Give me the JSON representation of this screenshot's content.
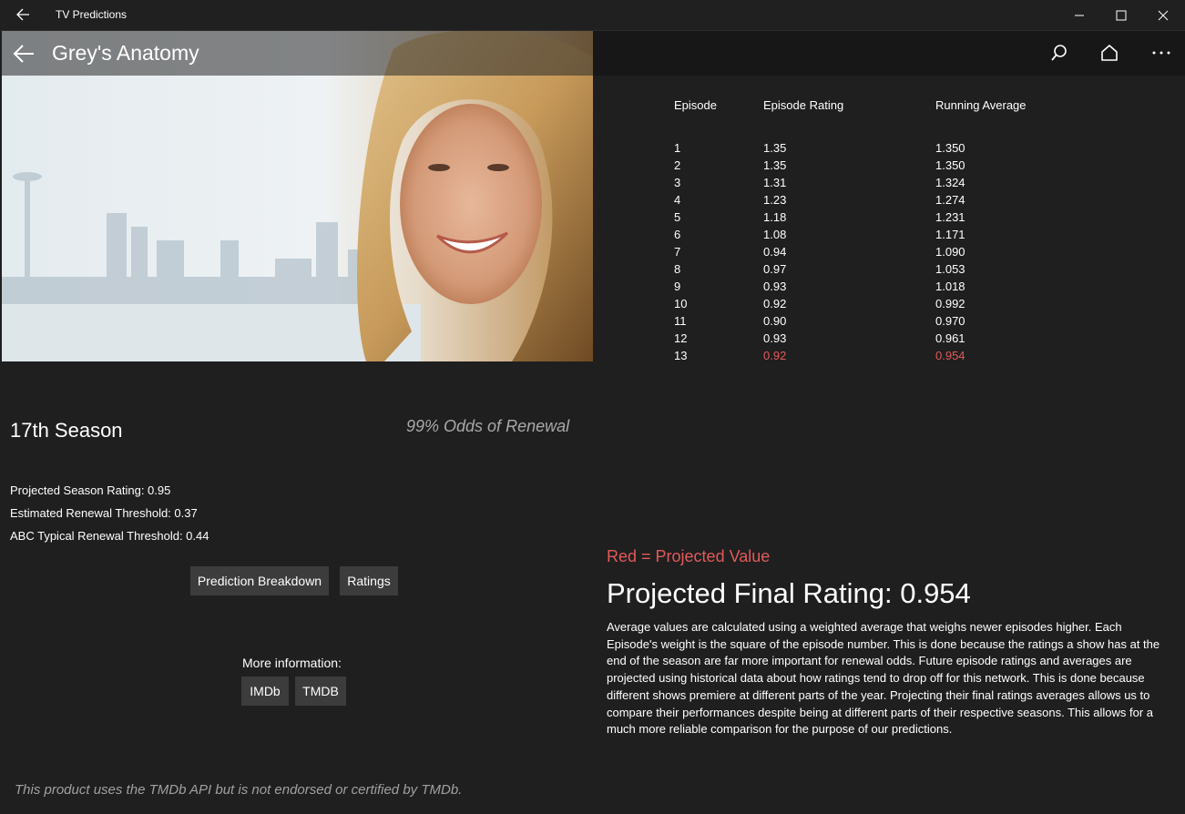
{
  "window": {
    "title": "TV Predictions",
    "back_icon": "back-arrow-icon",
    "controls": [
      "minimize-icon",
      "maximize-icon",
      "close-icon"
    ]
  },
  "header": {
    "show_title": "Grey's Anatomy",
    "back_icon": "back-arrow-icon",
    "actions": [
      "search-icon",
      "home-icon",
      "more-icon"
    ]
  },
  "ratings_table": {
    "headers": [
      "Episode",
      "Episode Rating",
      "Running Average"
    ],
    "rows": [
      {
        "episode": "1",
        "rating": "1.35",
        "average": "1.350",
        "projected": false
      },
      {
        "episode": "2",
        "rating": "1.35",
        "average": "1.350",
        "projected": false
      },
      {
        "episode": "3",
        "rating": "1.31",
        "average": "1.324",
        "projected": false
      },
      {
        "episode": "4",
        "rating": "1.23",
        "average": "1.274",
        "projected": false
      },
      {
        "episode": "5",
        "rating": "1.18",
        "average": "1.231",
        "projected": false
      },
      {
        "episode": "6",
        "rating": "1.08",
        "average": "1.171",
        "projected": false
      },
      {
        "episode": "7",
        "rating": "0.94",
        "average": "1.090",
        "projected": false
      },
      {
        "episode": "8",
        "rating": "0.97",
        "average": "1.053",
        "projected": false
      },
      {
        "episode": "9",
        "rating": "0.93",
        "average": "1.018",
        "projected": false
      },
      {
        "episode": "10",
        "rating": "0.92",
        "average": "0.992",
        "projected": false
      },
      {
        "episode": "11",
        "rating": "0.90",
        "average": "0.970",
        "projected": false
      },
      {
        "episode": "12",
        "rating": "0.93",
        "average": "0.961",
        "projected": false
      },
      {
        "episode": "13",
        "rating": "0.92",
        "average": "0.954",
        "projected": true
      }
    ]
  },
  "season": {
    "title": "17th Season",
    "odds": "99% Odds of Renewal",
    "stats": [
      "Projected Season Rating: 0.95",
      "Estimated Renewal Threshold: 0.37",
      "ABC Typical Renewal Threshold: 0.44"
    ],
    "buttons": {
      "breakdown": "Prediction Breakdown",
      "ratings": "Ratings"
    },
    "more_info": {
      "label": "More information:",
      "imdb": "IMDb",
      "tmdb": "TMDB"
    }
  },
  "projection": {
    "legend": "Red = Projected Value",
    "final_rating": "Projected Final Rating: 0.954",
    "explanation": "Average values are calculated using a weighted average that weighs newer episodes higher. Each Episode's weight is the square of the episode number. This is done because the ratings a show has at the end of the season are far more important for renewal odds. Future episode ratings and averages are projected using historical data about how ratings tend to drop off for this network. This is done because different shows premiere at different parts of the year. Projecting their final ratings averages allows us to compare their performances despite being at different parts of their respective seasons. This allows for a much more reliable comparison for the purpose of our predictions."
  },
  "footer": {
    "disclaimer": "This product uses the TMDb API but is not endorsed or certified by TMDb."
  },
  "colors": {
    "background": "#1f1f1f",
    "projected": "#e25a5a",
    "button": "#3c3c3c",
    "odds": "#a9a9a9"
  }
}
